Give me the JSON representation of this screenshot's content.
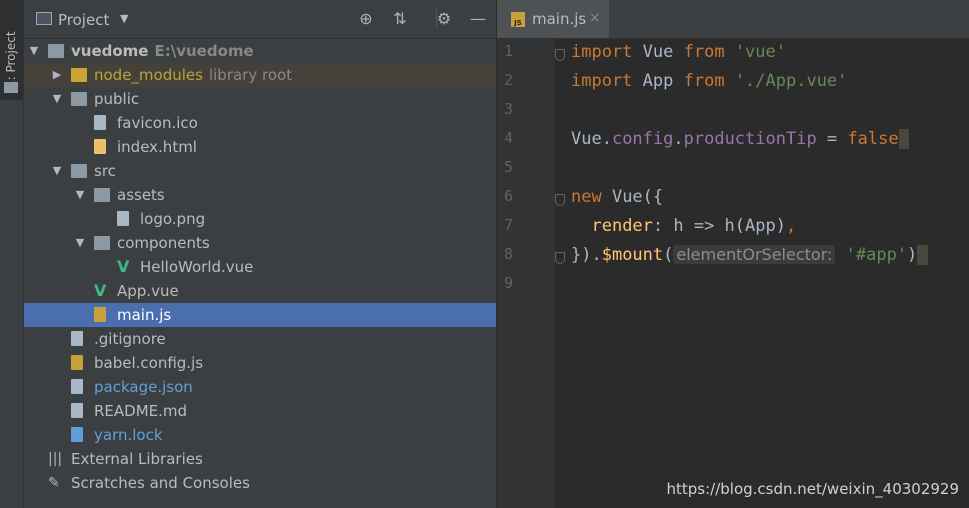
{
  "strip": {
    "label": "1: Project"
  },
  "project": {
    "title": "Project",
    "tree": [
      {
        "label": "vuedome",
        "extra": "E:\\vuedome",
        "depth": 0,
        "arrow": "down",
        "icon": "folder",
        "bold": true
      },
      {
        "label": "node_modules",
        "extra": "library root",
        "depth": 1,
        "arrow": "right",
        "icon": "folder-yellow",
        "lib": true
      },
      {
        "label": "public",
        "depth": 1,
        "arrow": "down",
        "icon": "folder"
      },
      {
        "label": "favicon.ico",
        "depth": 2,
        "icon": "file"
      },
      {
        "label": "index.html",
        "depth": 2,
        "icon": "html"
      },
      {
        "label": "src",
        "depth": 1,
        "arrow": "down",
        "icon": "folder"
      },
      {
        "label": "assets",
        "depth": 2,
        "arrow": "down",
        "icon": "folder"
      },
      {
        "label": "logo.png",
        "depth": 3,
        "icon": "file"
      },
      {
        "label": "components",
        "depth": 2,
        "arrow": "down",
        "icon": "folder"
      },
      {
        "label": "HelloWorld.vue",
        "depth": 3,
        "icon": "vue"
      },
      {
        "label": "App.vue",
        "depth": 2,
        "icon": "vue"
      },
      {
        "label": "main.js",
        "depth": 2,
        "icon": "js",
        "selected": true
      },
      {
        "label": ".gitignore",
        "depth": 1,
        "icon": "file"
      },
      {
        "label": "babel.config.js",
        "depth": 1,
        "icon": "js"
      },
      {
        "label": "package.json",
        "depth": 1,
        "icon": "json",
        "color": "#5f9fd8"
      },
      {
        "label": "README.md",
        "depth": 1,
        "icon": "md"
      },
      {
        "label": "yarn.lock",
        "depth": 1,
        "icon": "yarn",
        "color": "#5f9fd8"
      },
      {
        "label": "External Libraries",
        "depth": 0,
        "icon": "libs"
      },
      {
        "label": "Scratches and Consoles",
        "depth": 0,
        "icon": "scratch"
      }
    ]
  },
  "editor": {
    "tab_label": "main.js",
    "tab_close": "×",
    "line_numbers": [
      "1",
      "2",
      "3",
      "4",
      "5",
      "6",
      "7",
      "8",
      "9"
    ],
    "lines": [
      [
        {
          "t": "import",
          "c": "kw"
        },
        {
          "t": " Vue "
        },
        {
          "t": "from",
          "c": "kw"
        },
        {
          "t": " "
        },
        {
          "t": "'vue'",
          "c": "str"
        }
      ],
      [
        {
          "t": "import",
          "c": "kw"
        },
        {
          "t": " App "
        },
        {
          "t": "from",
          "c": "kw"
        },
        {
          "t": " "
        },
        {
          "t": "'./App.vue'",
          "c": "str"
        }
      ],
      [],
      [
        {
          "t": "Vue."
        },
        {
          "t": "config",
          "c": "prop"
        },
        {
          "t": "."
        },
        {
          "t": "productionTip",
          "c": "prop"
        },
        {
          "t": " = "
        },
        {
          "t": "false",
          "c": "kw"
        },
        {
          "t": " ",
          "c": "caret-box"
        }
      ],
      [],
      [
        {
          "t": "new",
          "c": "kw"
        },
        {
          "t": " Vue({"
        }
      ],
      [
        {
          "t": "  "
        },
        {
          "t": "render",
          "c": "fn"
        },
        {
          "t": ": h => h(App)"
        },
        {
          "t": ",",
          "c": "kw"
        }
      ],
      [
        {
          "t": "})."
        },
        {
          "t": "$mount",
          "c": "fn"
        },
        {
          "t": "("
        },
        {
          "t": "elementOrSelector:",
          "c": "hint"
        },
        {
          "t": " "
        },
        {
          "t": "'#app'",
          "c": "str"
        },
        {
          "t": ")"
        },
        {
          "t": " ",
          "c": "caret-box"
        }
      ],
      []
    ]
  },
  "watermark": "https://blog.csdn.net/weixin_40302929"
}
